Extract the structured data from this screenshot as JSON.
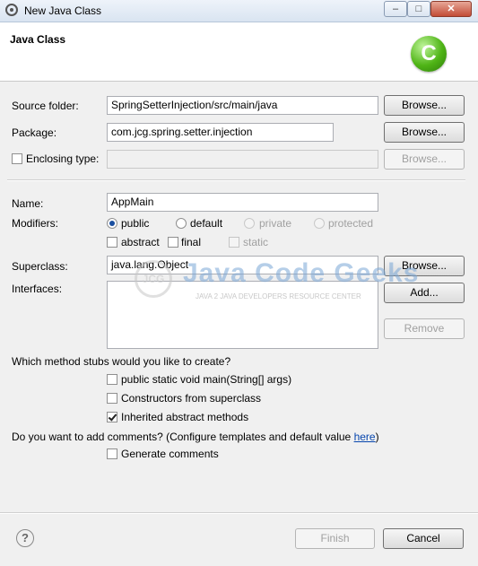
{
  "window": {
    "title": "New Java Class",
    "min_label": "–",
    "max_label": "□",
    "close_label": "✕"
  },
  "header": {
    "title": "Java Class",
    "logo_letter": "C"
  },
  "form": {
    "source_folder": {
      "label": "Source folder:",
      "value": "SpringSetterInjection/src/main/java",
      "browse": "Browse..."
    },
    "package": {
      "label": "Package:",
      "value": "com.jcg.spring.setter.injection",
      "browse": "Browse..."
    },
    "enclosing": {
      "label": "Enclosing type:",
      "value": "",
      "browse": "Browse...",
      "checked": false
    },
    "name": {
      "label": "Name:",
      "value": "AppMain"
    },
    "modifiers": {
      "label": "Modifiers:",
      "radios": [
        "public",
        "default",
        "private",
        "protected"
      ],
      "selected": "public",
      "checks": [
        "abstract",
        "final",
        "static"
      ]
    },
    "superclass": {
      "label": "Superclass:",
      "value": "java.lang.Object",
      "browse": "Browse..."
    },
    "interfaces": {
      "label": "Interfaces:",
      "add": "Add...",
      "remove": "Remove"
    },
    "stubs": {
      "question": "Which method stubs would you like to create?",
      "options": [
        {
          "label": "public static void main(String[] args)",
          "checked": false
        },
        {
          "label": "Constructors from superclass",
          "checked": false
        },
        {
          "label": "Inherited abstract methods",
          "checked": true
        }
      ]
    },
    "comments": {
      "question": "Do you want to add comments? (Configure templates and default value ",
      "link": "here",
      "close_paren": ")",
      "option": "Generate comments",
      "checked": false
    }
  },
  "watermark": {
    "logo": "JCG",
    "name": "Java Code Geeks",
    "tagline": "JAVA 2 JAVA DEVELOPERS RESOURCE CENTER"
  },
  "footer": {
    "help": "?",
    "finish": "Finish",
    "cancel": "Cancel"
  }
}
